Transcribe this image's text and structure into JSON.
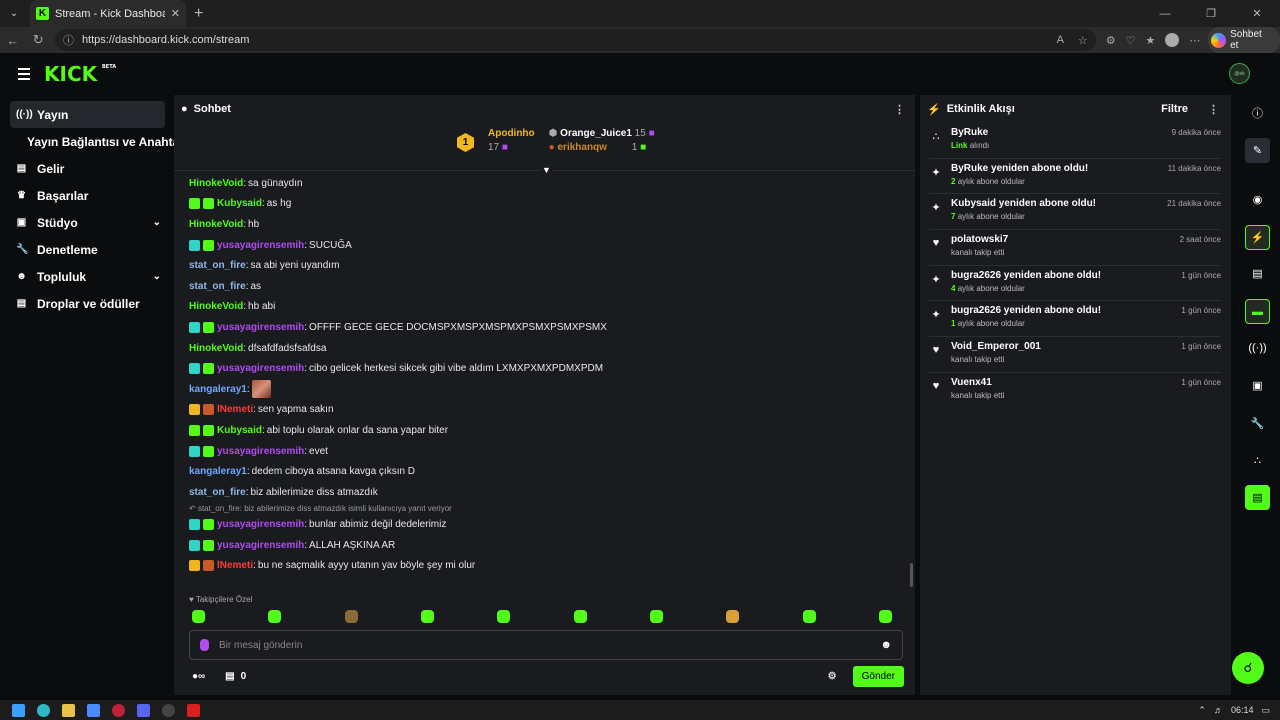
{
  "browser": {
    "tab_title": "Stream - Kick Dashboard",
    "url": "https://dashboard.kick.com/stream",
    "copilot_label": "Sohbet et"
  },
  "brand": {
    "logo": "KICK",
    "beta": "BETA",
    "avatar_text": "@ek"
  },
  "colors": {
    "accent": "#53fc18",
    "panel": "#191b1f",
    "bg": "#0b0c0d",
    "gold": "#f1b81e",
    "purple": "#b04cf0"
  },
  "sidebar": {
    "items": [
      {
        "label": "Yayın",
        "icon": "broadcast-icon"
      },
      {
        "label": "Yayın Bağlantısı ve Anahtarı",
        "icon": ""
      },
      {
        "label": "Gelir",
        "icon": "chart-icon"
      },
      {
        "label": "Başarılar",
        "icon": "trophy-icon"
      },
      {
        "label": "Stüdyo",
        "icon": "studio-icon"
      },
      {
        "label": "Denetleme",
        "icon": "wrench-icon"
      },
      {
        "label": "Topluluk",
        "icon": "people-icon"
      },
      {
        "label": "Droplar ve ödüller",
        "icon": "gift-icon"
      }
    ]
  },
  "chat": {
    "title": "Sohbet",
    "leaderboard": [
      {
        "rank": "1",
        "name": "Apodinho",
        "count": "17"
      },
      {
        "name": "Orange_Juice1",
        "count": "15"
      },
      {
        "name": "erikhanqw",
        "count": "1"
      }
    ],
    "messages": [
      {
        "user": "HinokeVoid",
        "text": "sa günaydın",
        "color": "#53fc18",
        "badges": []
      },
      {
        "user": "Kubysaid",
        "text": "as hg",
        "color": "#53fc18",
        "badges": [
          "#53fc18",
          "#53fc18"
        ]
      },
      {
        "user": "HinokeVoid",
        "text": "hb",
        "color": "#53fc18",
        "badges": []
      },
      {
        "user": "yusayagirensemih",
        "text": "SUCUĞA",
        "color": "#b04cf0",
        "badges": [
          "#2fd6c8",
          "#53fc18"
        ]
      },
      {
        "user": "stat_on_fire",
        "text": "sa abi yeni uyandım",
        "color": "#8fb8e8",
        "badges": []
      },
      {
        "user": "stat_on_fire",
        "text": "as",
        "color": "#8fb8e8",
        "badges": []
      },
      {
        "user": "HinokeVoid",
        "text": "hb abi",
        "color": "#53fc18",
        "badges": []
      },
      {
        "user": "yusayagirensemih",
        "text": "OFFFF GECE GECE DOCMSPXMSPXMSPMXPSMXPSMXPSMX",
        "color": "#b04cf0",
        "badges": [
          "#2fd6c8",
          "#53fc18"
        ]
      },
      {
        "user": "HinokeVoid",
        "text": "dfsafdfadsfsafdsa",
        "color": "#53fc18",
        "badges": []
      },
      {
        "user": "yusayagirensemih",
        "text": "cibo gelicek herkesi sikcek gibi vibe aldım LXMXPXMXPDMXPDM",
        "color": "#b04cf0",
        "badges": [
          "#2fd6c8",
          "#53fc18"
        ]
      },
      {
        "user": "kangaleray1",
        "text": "",
        "color": "#6fa8ff",
        "badges": [],
        "emote": true
      },
      {
        "user": "lNemeti",
        "text": "sen yapma sakın",
        "color": "#ff3b3b",
        "badges": [
          "#f1b81e",
          "#c85a2a"
        ]
      },
      {
        "user": "Kubysaid",
        "text": "abi toplu olarak onlar da sana yapar biter",
        "color": "#53fc18",
        "badges": [
          "#53fc18",
          "#53fc18"
        ]
      },
      {
        "user": "yusayagirensemih",
        "text": "evet",
        "color": "#b04cf0",
        "badges": [
          "#2fd6c8",
          "#53fc18"
        ]
      },
      {
        "user": "kangaleray1",
        "text": "dedem ciboya atsana kavga çıksın D",
        "color": "#6fa8ff",
        "badges": []
      },
      {
        "user": "stat_on_fire",
        "text": "biz abilerimize diss atmazdık",
        "color": "#8fb8e8",
        "badges": []
      }
    ],
    "reply_note": "stat_on_fire: biz abilerimize diss atmazdık isimli kullanıcıya yanıt veriyor",
    "messages2": [
      {
        "user": "yusayagirensemih",
        "text": "bunlar abimiz değil dedelerimiz",
        "color": "#b04cf0",
        "badges": [
          "#2fd6c8",
          "#53fc18"
        ]
      },
      {
        "user": "yusayagirensemih",
        "text": "ALLAH AŞKINA AR",
        "color": "#b04cf0",
        "badges": [
          "#2fd6c8",
          "#53fc18"
        ]
      },
      {
        "user": "lNemeti",
        "text": "bu ne saçmalık ayyy utanın yav böyle şey mi olur",
        "color": "#ff3b3b",
        "badges": [
          "#f1b81e",
          "#c85a2a"
        ]
      }
    ],
    "followers_only": "Takipçilere Özel",
    "input_placeholder": "Bir mesaj gönderin",
    "points": "0",
    "send_label": "Gönder"
  },
  "activity": {
    "title": "Etkinlik Akışı",
    "filter_label": "Filtre",
    "items": [
      {
        "top": "ByRuke",
        "sub_hl": "Link",
        "sub": "alındı",
        "time": "9 dakika önce",
        "icon": "drop-icon"
      },
      {
        "top": "ByRuke yeniden abone oldu!",
        "sub_hl": "2",
        "sub": "aylık abone oldular",
        "time": "11 dakika önce",
        "icon": "sparkle-icon"
      },
      {
        "top": "Kubysaid yeniden abone oldu!",
        "sub_hl": "7",
        "sub": "aylık abone oldular",
        "time": "21 dakika önce",
        "icon": "sparkle-icon"
      },
      {
        "top": "polatowski7",
        "sub_hl": "",
        "sub": "kanalı takip etti",
        "time": "2 saat önce",
        "icon": "heart-icon"
      },
      {
        "top": "bugra2626 yeniden abone oldu!",
        "sub_hl": "4",
        "sub": "aylık abone oldular",
        "time": "1 gün önce",
        "icon": "sparkle-icon"
      },
      {
        "top": "bugra2626 yeniden abone oldu!",
        "sub_hl": "1",
        "sub": "aylık abone oldular",
        "time": "1 gün önce",
        "icon": "sparkle-icon"
      },
      {
        "top": "Void_Emperor_001",
        "sub_hl": "",
        "sub": "kanalı takip etti",
        "time": "1 gün önce",
        "icon": "heart-icon"
      },
      {
        "top": "Vuenx41",
        "sub_hl": "",
        "sub": "kanalı takip etti",
        "time": "1 gün önce",
        "icon": "heart-icon"
      }
    ]
  },
  "taskbar": {
    "time": "06:14"
  }
}
